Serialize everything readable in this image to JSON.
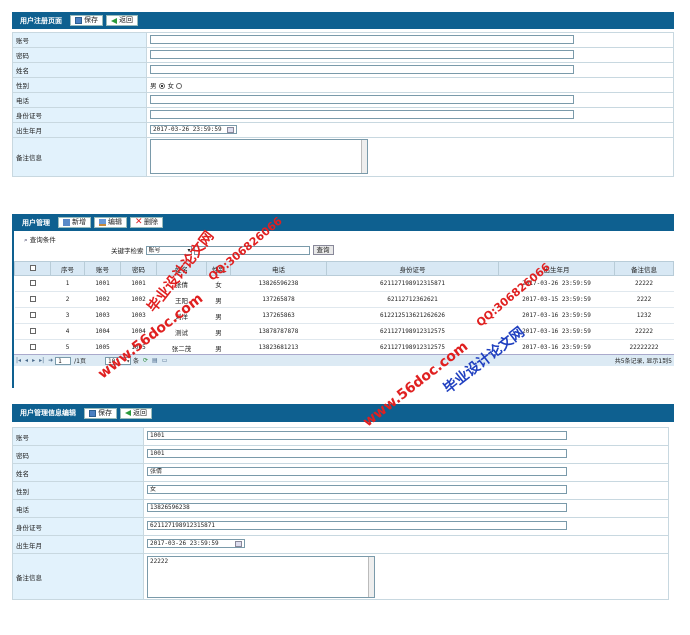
{
  "register": {
    "title": "用户注册页面",
    "save": "保存",
    "back": "返回",
    "labels": {
      "account": "账号",
      "password": "密码",
      "name": "姓名",
      "gender": "性别",
      "phone": "电话",
      "idcard": "身份证号",
      "birth": "出生年月",
      "remark": "备注信息"
    },
    "gender_male": "男",
    "gender_female": "女",
    "gender_selected": "男",
    "birth_value": "2017-03-26 23:59:59"
  },
  "manage": {
    "title": "用户管理",
    "add": "新增",
    "edit": "编辑",
    "delete": "删除",
    "query_label": "查询条件",
    "keyword_label": "关键字检索",
    "keyword_option": "账号",
    "query_btn": "查询",
    "columns": [
      "序号",
      "账号",
      "密码",
      "姓名",
      "性别",
      "电话",
      "身份证号",
      "出生年月",
      "备注信息"
    ],
    "rows": [
      [
        "1",
        "1001",
        "1001",
        "张倩",
        "女",
        "13826596238",
        "621127198912315871",
        "2017-03-26 23:59:59",
        "22222"
      ],
      [
        "2",
        "1002",
        "1002",
        "王阳",
        "男",
        "137265878",
        "62112712362621",
        "2017-03-15 23:59:59",
        "2222"
      ],
      [
        "3",
        "1003",
        "1003",
        "刘洋",
        "男",
        "137265863",
        "612212513621262626",
        "2017-03-16 23:59:59",
        "1232"
      ],
      [
        "4",
        "1004",
        "1004",
        "测试",
        "男",
        "13878787878",
        "621127198912312575",
        "2017-03-16 23:59:59",
        "22222"
      ],
      [
        "5",
        "1005",
        "1005",
        "张二茂",
        "男",
        "13823681213",
        "621127198912312575",
        "2017-03-16 23:59:59",
        "22222222"
      ]
    ],
    "pager": {
      "page_input": "1",
      "page_total": "/1页",
      "page_size": "10",
      "per": "条",
      "summary": "共5条记录, 显示1到5"
    }
  },
  "editform": {
    "title": "用户管理信息编辑",
    "save": "保存",
    "back": "返回",
    "labels": {
      "account": "账号",
      "password": "密码",
      "name": "姓名",
      "gender": "性别",
      "phone": "电话",
      "idcard": "身份证号",
      "birth": "出生年月",
      "remark": "备注信息"
    },
    "values": {
      "account": "1001",
      "password": "1001",
      "name": "张倩",
      "gender": "女",
      "phone": "13826596238",
      "idcard": "621127198912315871",
      "birth": "2017-03-26 23:59:59",
      "remark": "22222"
    }
  },
  "watermarks": {
    "site": "www.56doc.com",
    "brand": "毕业设计论文网",
    "qq": "QQ:306826066"
  },
  "colors": {
    "header": "#0e6090",
    "label_bg": "#e2f2fc",
    "watermark_red": "#e02020",
    "watermark_blue": "#2040c0"
  }
}
